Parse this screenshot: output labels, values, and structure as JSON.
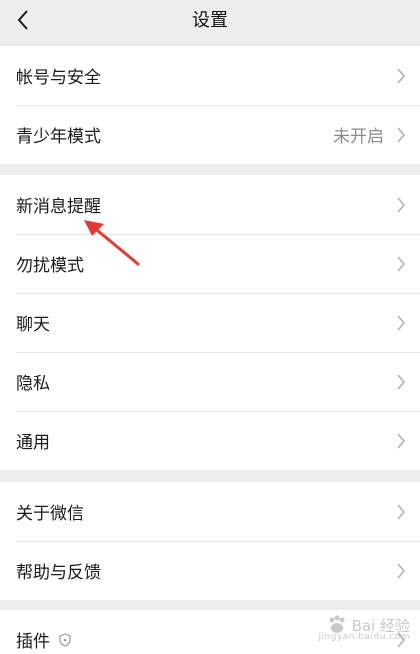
{
  "nav": {
    "title": "设置"
  },
  "groups": [
    {
      "items": [
        {
          "label": "帐号与安全"
        },
        {
          "label": "青少年模式",
          "value": "未开启"
        }
      ]
    },
    {
      "items": [
        {
          "label": "新消息提醒"
        },
        {
          "label": "勿扰模式"
        },
        {
          "label": "聊天"
        },
        {
          "label": "隐私"
        },
        {
          "label": "通用"
        }
      ]
    },
    {
      "items": [
        {
          "label": "关于微信"
        },
        {
          "label": "帮助与反馈"
        }
      ]
    },
    {
      "items": [
        {
          "label": "插件"
        }
      ]
    }
  ],
  "annotation": {
    "color": "#e53935",
    "target": "新消息提醒"
  },
  "watermark": {
    "text": "Bai 经验",
    "sub": "jingyan.baidu.com"
  },
  "colors": {
    "background": "#ededed",
    "row_background": "#ffffff",
    "value_text": "#8c8c8c",
    "chevron": "#b2b2b2"
  }
}
